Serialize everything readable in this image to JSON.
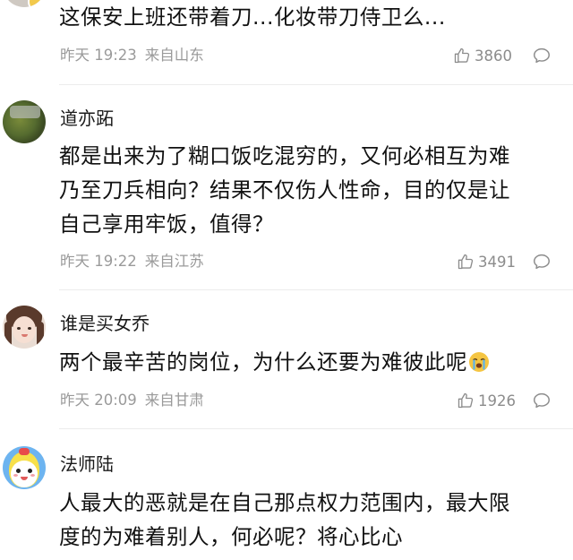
{
  "comments": [
    {
      "username": "",
      "lines": [
        "这保安上班还带着刀...化妆带刀侍卫么..."
      ],
      "time": "昨天 19:23",
      "location": "来自山东",
      "likes": "3860"
    },
    {
      "username": "道亦跖",
      "lines": [
        "都是出来为了糊口饭吃混穷的，又何必相互为难",
        "乃至刀兵相向？结果不仅伤人性命，目的仅是让",
        "自己享用牢饭，值得？"
      ],
      "time": "昨天 19:22",
      "location": "来自江苏",
      "likes": "3491"
    },
    {
      "username": "谁是买女乔",
      "lines": [
        "两个最辛苦的岗位，为什么还要为难彼此呢"
      ],
      "time": "昨天 20:09",
      "location": "来自甘肃",
      "likes": "1926"
    },
    {
      "username": "法师陆",
      "lines": [
        "人最大的恶就是在自己那点权力范围内，最大限",
        "度的为难着别人，何必呢？将心比心"
      ],
      "time": "",
      "location": "",
      "likes": ""
    }
  ],
  "icons": {
    "like": "thumbs-up-icon",
    "reply": "comment-bubble-icon",
    "emoji": "loudly-crying-face-emoji"
  },
  "colors": {
    "meta_text": "#9a9a9a",
    "divider": "#ececec"
  }
}
